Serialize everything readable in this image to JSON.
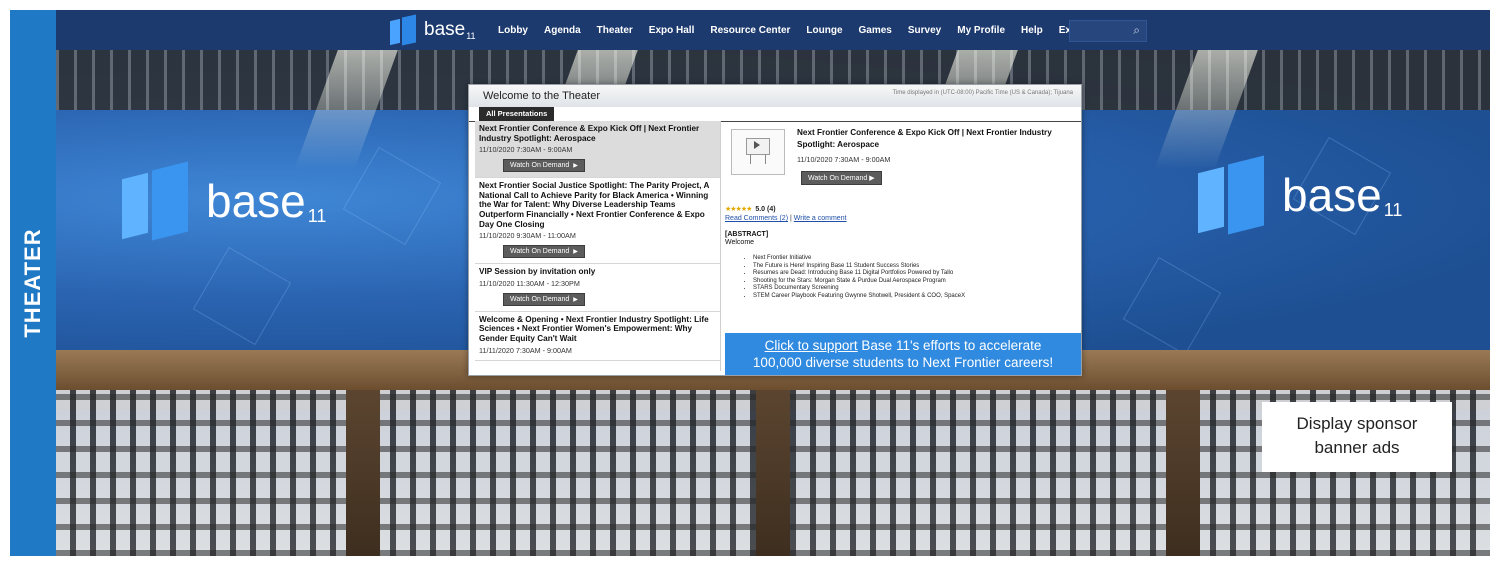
{
  "side_label": "THEATER",
  "nav": {
    "logo_word": "base",
    "logo_sub": "11",
    "items": [
      "Lobby",
      "Agenda",
      "Theater",
      "Expo Hall",
      "Resource Center",
      "Lounge",
      "Games",
      "Survey",
      "My Profile",
      "Help",
      "Exit"
    ],
    "search_icon": "search-icon"
  },
  "brand_left": {
    "word": "base",
    "sub": "11"
  },
  "brand_right": {
    "word": "base",
    "sub": "11"
  },
  "panel": {
    "title": "Welcome to the Theater",
    "timezone": "Time displayed in (UTC-08:00) Pacific Time (US & Canada); Tijuana",
    "tab": "All Presentations",
    "items": [
      {
        "title": "Next Frontier Conference & Expo Kick Off | Next Frontier Industry Spotlight: Aerospace",
        "date": "11/10/2020 7:30AM - 9:00AM",
        "button": "Watch On Demand"
      },
      {
        "title": "Next Frontier Social Justice Spotlight: The Parity Project, A National Call to Achieve Parity for Black America • Winning the War for Talent: Why Diverse Leadership Teams Outperform Financially • Next Frontier Conference & Expo Day One Closing",
        "date": "11/10/2020 9:30AM - 11:00AM",
        "button": "Watch On Demand"
      },
      {
        "title": "VIP Session by invitation only",
        "date": "11/10/2020 11:30AM - 12:30PM",
        "button": "Watch On Demand"
      },
      {
        "title": "Welcome & Opening • Next Frontier Industry Spotlight: Life Sciences • Next Frontier Women's Empowerment: Why Gender Equity Can't Wait",
        "date": "11/11/2020 7:30AM - 9:00AM",
        "button": ""
      }
    ],
    "detail": {
      "title": "Next Frontier Conference & Expo Kick Off | Next Frontier Industry Spotlight: Aerospace",
      "date": "11/10/2020 7:30AM - 9:00AM",
      "button": "Watch On Demand",
      "stars": "★★★★★",
      "rating": "5.0 (4)",
      "read_comments": "Read Comments (2)",
      "separator": "|",
      "write_comment": "Write a comment",
      "abstract_heading": "[ABSTRACT]",
      "abstract_welcome": "Welcome",
      "bullets": [
        "Next Frontier Initiative",
        "The Future is Here! Inspiring Base 11 Student Success Stories",
        "Resumes are Dead: Introducing Base 11 Digital Portfolios Powered by Tallo",
        "Shooting for the Stars: Morgan State & Purdue Dual Aerospace Program",
        "STARS Documentary Screening",
        "STEM Career Playbook Featuring Gwynne Shotwell, President & COO, SpaceX"
      ]
    },
    "support": {
      "link": "Click to support",
      "text1": " Base 11's efforts to accelerate",
      "text2": "100,000 diverse students to Next Frontier careers!"
    }
  },
  "callout": {
    "line1": "Display sponsor",
    "line2": "banner ads"
  },
  "colors": {
    "accent": "#1f79c4",
    "nav_bg": "#1c3a6e",
    "support_bg": "#2f8ae0"
  }
}
